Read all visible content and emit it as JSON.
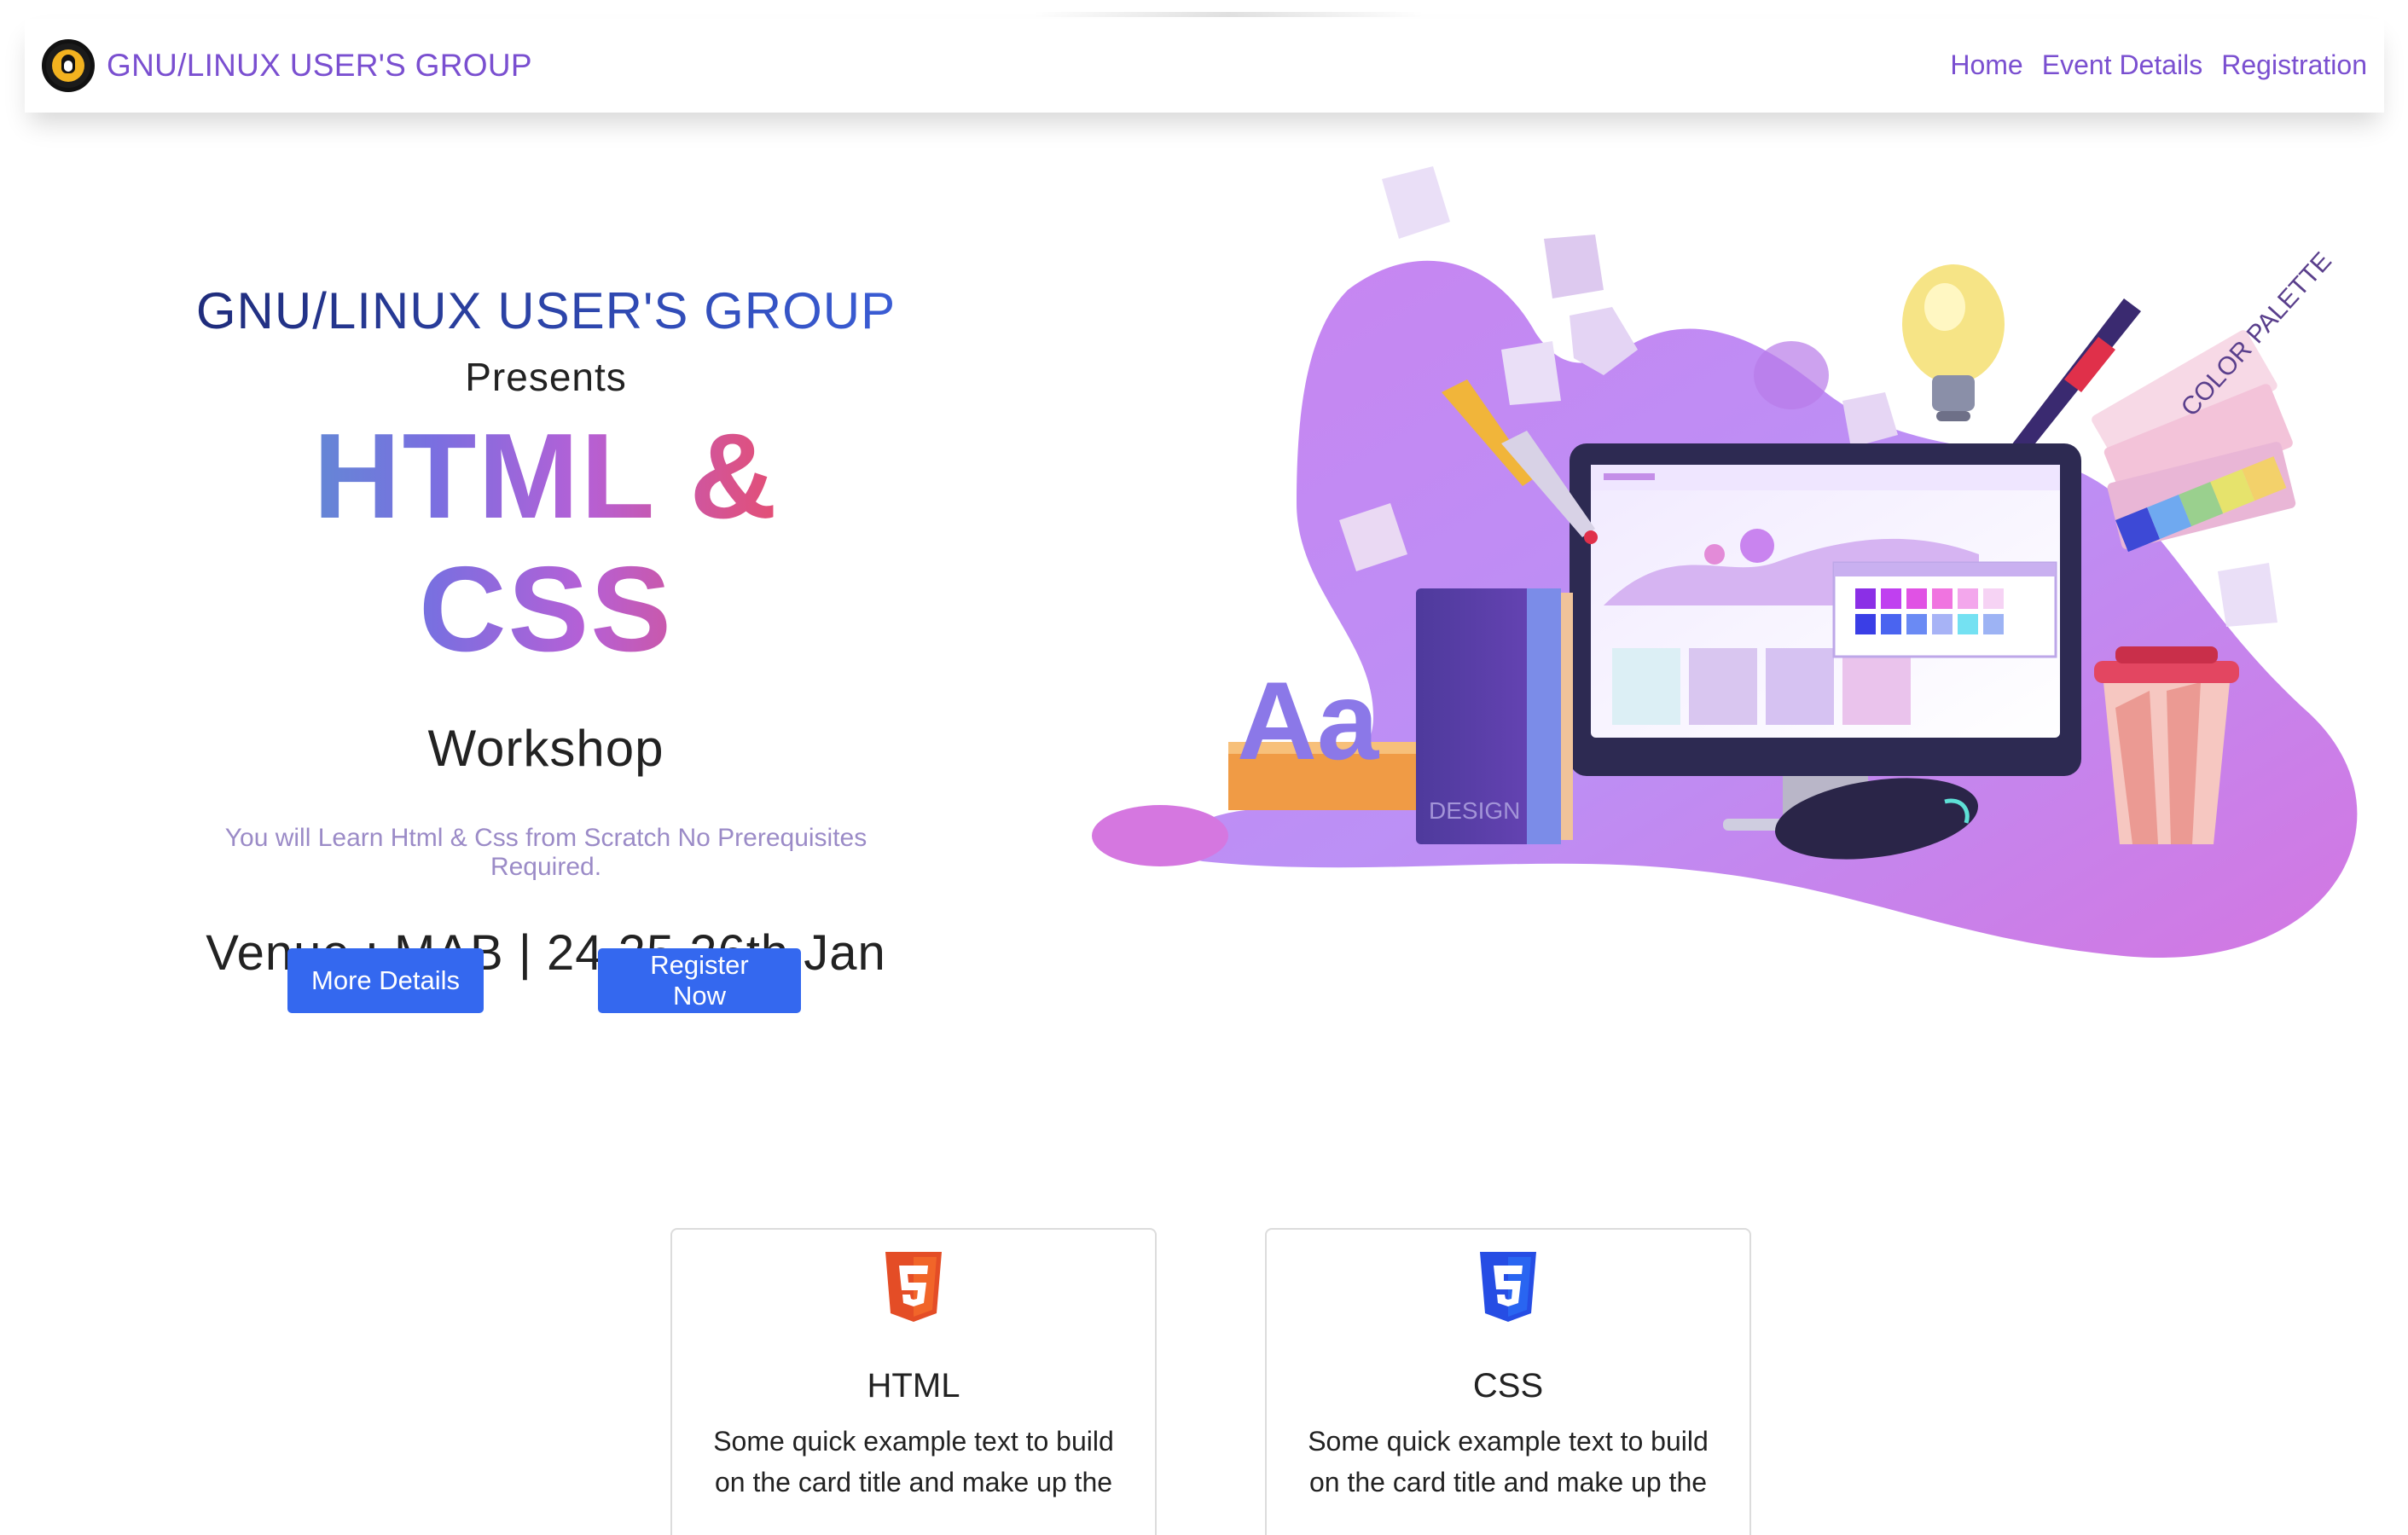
{
  "navbar": {
    "brand": "GNU/LINUX USER'S GROUP",
    "links": [
      "Home",
      "Event Details",
      "Registration"
    ]
  },
  "hero": {
    "org": "GNU/LINUX USER'S GROUP",
    "presents": "Presents",
    "title": "HTML & CSS",
    "subtitle_title": "Workshop",
    "description": "You will Learn Html & Css from Scratch No Prerequisites Required.",
    "venue": "Venue : MAB | 24,25,26th Jan",
    "more_button": "More Details",
    "register_button": "Register Now"
  },
  "illustration": {
    "book_label": "DESIGN",
    "palette_label": "COLOR PALETTE",
    "ruler_letters": "Aa"
  },
  "cards": [
    {
      "title": "HTML",
      "icon": "html5-icon",
      "text": "Some quick example text to build on the card title and make up the"
    },
    {
      "title": "CSS",
      "icon": "css3-icon",
      "text": "Some quick example text to build on the card title and make up the"
    }
  ],
  "colors": {
    "brand": "#7a4fd0",
    "button": "#3468ef",
    "html": "#e44d26",
    "css": "#264de4"
  }
}
